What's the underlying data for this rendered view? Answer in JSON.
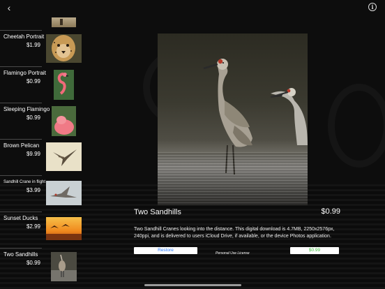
{
  "nav": {
    "back_icon": "chevron-left-icon",
    "info_icon": "info-icon",
    "back_glyph": "‹",
    "info_glyph": "i"
  },
  "sidebar": {
    "items": [
      {
        "title": "Cheetah Portrait",
        "price": "$1.99"
      },
      {
        "title": "Flamingo Portrait",
        "price": "$0.99"
      },
      {
        "title": "Sleeping Flamingo",
        "price": "$0.99"
      },
      {
        "title": "Brown Pelican",
        "price": "$9.99"
      },
      {
        "title": "Sandhill Crane in flight",
        "price": "$3.99"
      },
      {
        "title": "Sunset Ducks",
        "price": "$2.99"
      },
      {
        "title": "Two Sandhills",
        "price": "$0.99"
      }
    ]
  },
  "detail": {
    "title": "Two Sandhills",
    "price": "$0.99",
    "description": "Two Sandhill Cranes looking into the distance. This digital download is 4.7MB, 2250x2576px, 240ppi, and is delivered to users iCloud Drive, if available, or the device Photos application.",
    "restore_label": "Restore",
    "license_label": "Personal Use License",
    "buy_label": "$0.99"
  },
  "colors": {
    "restore_text": "#2a7bff",
    "buy_text": "#3fbf3f",
    "background": "#0d0d0d"
  }
}
